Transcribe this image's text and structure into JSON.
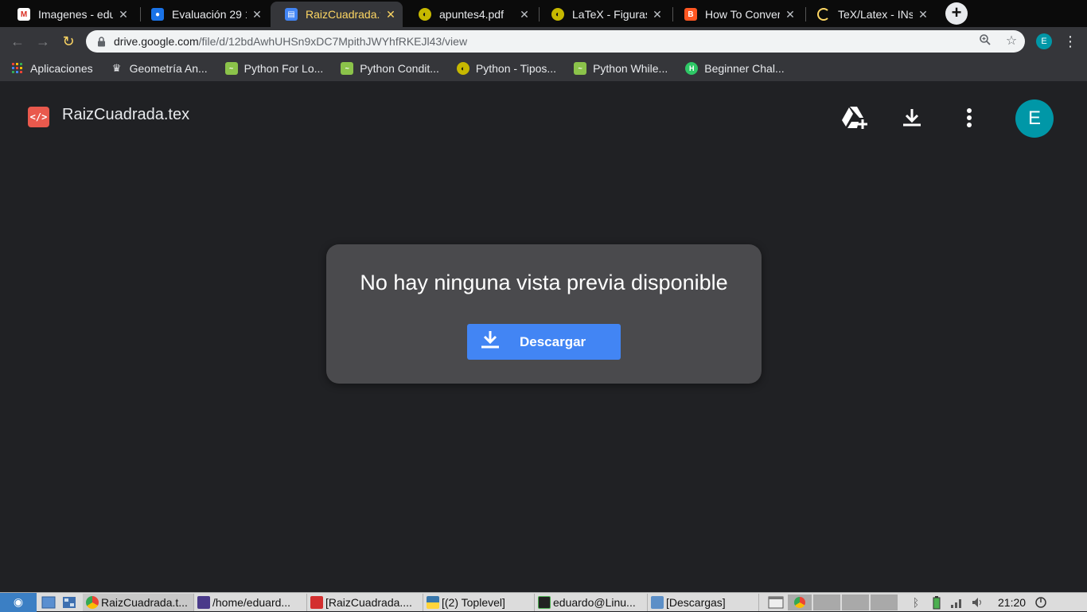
{
  "tabs": [
    {
      "title": "Imagenes - edu",
      "icon": "gmail-icon",
      "color": "#d93025"
    },
    {
      "title": "Evaluación 29 1",
      "icon": "classroom-icon",
      "color": "#1a73e8"
    },
    {
      "title": "RaizCuadrada.t",
      "icon": "drive-file-icon",
      "color": "#4285f4"
    },
    {
      "title": "apuntes4.pdf",
      "icon": "overleaf-icon",
      "color": "#c6b800"
    },
    {
      "title": "LaTeX - Figuras",
      "icon": "overleaf-icon",
      "color": "#c6b800"
    },
    {
      "title": "How To Conver",
      "icon": "blogger-icon",
      "color": "#ff5722"
    },
    {
      "title": "TeX/Latex - INs",
      "icon": "loading-icon",
      "color": "#fdd663"
    }
  ],
  "omnibox": {
    "domain": "drive.google.com",
    "path": "/file/d/12bdAwhUHSn9xDC7MpithJWYhfRKEJl43/view"
  },
  "profile_initial": "E",
  "bookmarks": [
    {
      "label": "Aplicaciones",
      "icon": "apps-grid-icon"
    },
    {
      "label": "Geometría An...",
      "icon": "trophy-icon"
    },
    {
      "label": "Python For Lo...",
      "icon": "python-icon"
    },
    {
      "label": "Python Condit...",
      "icon": "python-icon"
    },
    {
      "label": "Python - Tipos...",
      "icon": "globe-icon"
    },
    {
      "label": "Python While...",
      "icon": "python-icon"
    },
    {
      "label": "Beginner Chal...",
      "icon": "hackerrank-icon"
    }
  ],
  "viewer": {
    "file_name": "RaizCuadrada.tex",
    "avatar_initial": "E",
    "message": "No hay ninguna vista previa disponible",
    "download_label": "Descargar"
  },
  "taskbar": {
    "tasks": [
      {
        "label": "RaizCuadrada.t...",
        "icon": "chrome-icon"
      },
      {
        "label": "/home/eduard...",
        "icon": "file-manager-icon"
      },
      {
        "label": "[RaizCuadrada....",
        "icon": "pdf-icon"
      },
      {
        "label": "[(2) Toplevel]",
        "icon": "python-icon"
      },
      {
        "label": "eduardo@Linu...",
        "icon": "terminal-icon"
      },
      {
        "label": "[Descargas]",
        "icon": "folder-icon"
      }
    ],
    "clock": "21:20"
  },
  "colors": {
    "accent": "#4285f4",
    "avatar": "#0097a7",
    "active_tab_text": "#fdd663",
    "file_icon": "#e9594d"
  }
}
